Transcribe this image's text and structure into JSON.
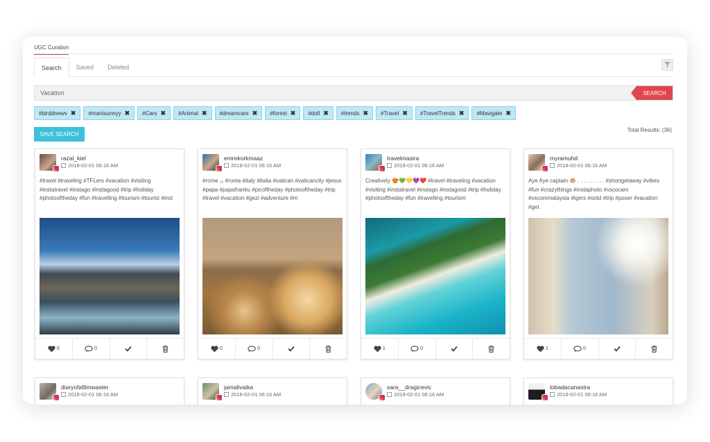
{
  "section_title": "UGC Curation",
  "tabs": [
    {
      "label": "Search",
      "active": true
    },
    {
      "label": "Saved",
      "active": false
    },
    {
      "label": "Deleted",
      "active": false
    }
  ],
  "search": {
    "value": "Vacation",
    "button": "SEARCH"
  },
  "tags": [
    "#birddnewv",
    "#manisunnyy",
    "#Cars",
    "#Animal",
    "#dreamcars",
    "#forest",
    "#doll",
    "#trends",
    "#Travel",
    "#TravelTrends",
    "#Mavigate"
  ],
  "save_search_label": "SAVE SEARCH",
  "total_results": "Total Results: (36)",
  "posts": [
    {
      "user": "razal_kiel",
      "date": "2018-02-01 06:16 AM",
      "caption": "#travel #traveling #TFLers #vacation #visiting #instatravel #instago #instagood #trip #holiday #photooftheday #fun #travelling #tourism #tourist #inst",
      "likes": "0",
      "comments": "0"
    },
    {
      "user": "emrekorkmaaz",
      "date": "2018-02-01 06:16 AM",
      "caption": "#rome ₁₁ #roma #italy #italia #vatican #vaticancity #jesus #papa #papafranku #picoftheday #photooftheday #trip #travel #vacation #gezi #adventure #m",
      "likes": "0",
      "comments": "0"
    },
    {
      "user": "travelmasira",
      "date": "2018-02-01 06:16 AM",
      "caption": "Creativety 😍💚💛💜❤️ #travel #traveling #vacation #visiting #instatravel #instago #instagood #trip #holiday #photooftheday #fun #travelling #tourism",
      "likes": "1",
      "comments": "0"
    },
    {
      "user": "myramuhd",
      "date": "2018-02-01 06:16 AM",
      "caption": "Aye Aye captain 🐵 . . . . . . . . . #shortgetaway #vibes #fun #crazythings #instaphoto #vscocam #vscommalaysia #igers #ootd #trip #poser #vacation #get",
      "likes": "1",
      "comments": "0"
    },
    {
      "user": "diaryofafilmwaster",
      "date": "2018-02-01 06:16 AM"
    },
    {
      "user": "jamalivaika",
      "date": "2018-02-01 06:16 AM"
    },
    {
      "user": "sara__dragicevic",
      "date": "2018-02-01 06:16 AM"
    },
    {
      "user": "lobadacanastra",
      "date": "2018-02-01 06:16 AM"
    }
  ],
  "colors": {
    "accent": "#e0464d",
    "cyan": "#3ec0dc",
    "tag_bg": "#bfe7f4"
  }
}
